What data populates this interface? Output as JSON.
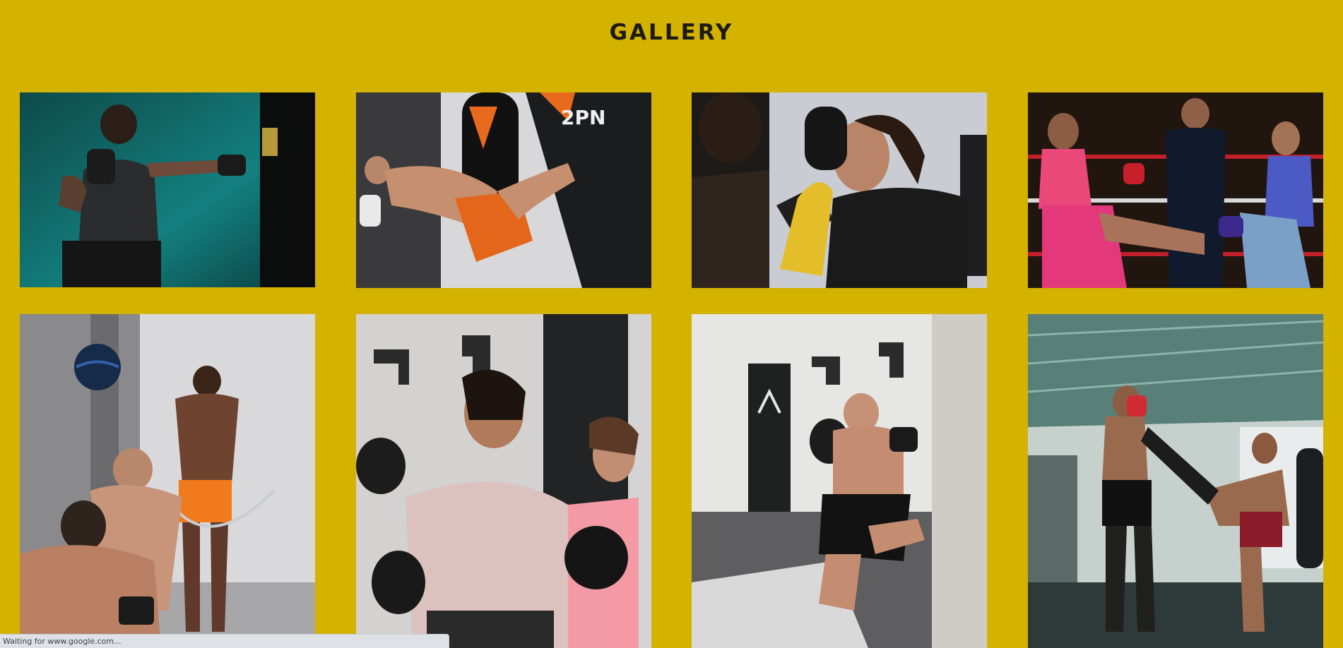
{
  "page": {
    "title": "GALLERY",
    "background_color": "#d4b200"
  },
  "gallery": {
    "images": [
      {
        "subject": "boxer punching heavy bag against teal wall"
      },
      {
        "subject": "fighter in orange shorts kicking heavy bag"
      },
      {
        "subject": "woman boxer with gloves and trainer with pads"
      },
      {
        "subject": "two women fighters kicking in ring with referee"
      },
      {
        "subject": "athletes training with medicine ball and jump rope"
      },
      {
        "subject": "two smiling women wearing boxing gloves"
      },
      {
        "subject": "man kneeing a white heavy bag in gym"
      },
      {
        "subject": "two muay thai fighters sparring under metal roof"
      }
    ]
  },
  "status_bar": {
    "text": "Waiting for www.google.com..."
  }
}
